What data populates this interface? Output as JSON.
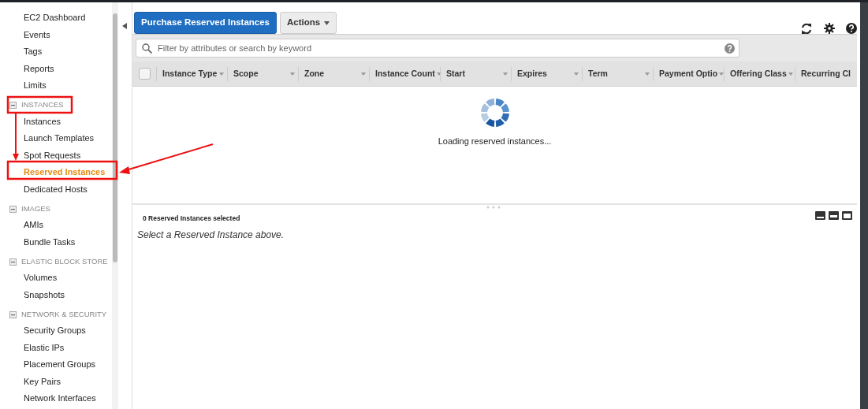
{
  "sidebar": {
    "items": [
      {
        "kind": "link",
        "label": "EC2 Dashboard",
        "selected": false
      },
      {
        "kind": "link",
        "label": "Events",
        "selected": false
      },
      {
        "kind": "link",
        "label": "Tags",
        "selected": false
      },
      {
        "kind": "link",
        "label": "Reports",
        "selected": false
      },
      {
        "kind": "link",
        "label": "Limits",
        "selected": false
      },
      {
        "kind": "section",
        "label": "INSTANCES",
        "expanded": true
      },
      {
        "kind": "link",
        "label": "Instances",
        "selected": false
      },
      {
        "kind": "link",
        "label": "Launch Templates",
        "selected": false
      },
      {
        "kind": "link",
        "label": "Spot Requests",
        "selected": false
      },
      {
        "kind": "link",
        "label": "Reserved Instances",
        "selected": true
      },
      {
        "kind": "link",
        "label": "Dedicated Hosts",
        "selected": false
      },
      {
        "kind": "section",
        "label": "IMAGES",
        "expanded": true
      },
      {
        "kind": "link",
        "label": "AMIs",
        "selected": false
      },
      {
        "kind": "link",
        "label": "Bundle Tasks",
        "selected": false
      },
      {
        "kind": "section",
        "label": "ELASTIC BLOCK STORE",
        "expanded": true
      },
      {
        "kind": "link",
        "label": "Volumes",
        "selected": false
      },
      {
        "kind": "link",
        "label": "Snapshots",
        "selected": false
      },
      {
        "kind": "section",
        "label": "NETWORK & SECURITY",
        "expanded": true
      },
      {
        "kind": "link",
        "label": "Security Groups",
        "selected": false
      },
      {
        "kind": "link",
        "label": "Elastic IPs",
        "selected": false
      },
      {
        "kind": "link",
        "label": "Placement Groups",
        "selected": false
      },
      {
        "kind": "link",
        "label": "Key Pairs",
        "selected": false
      },
      {
        "kind": "link",
        "label": "Network Interfaces",
        "selected": false
      }
    ]
  },
  "toolbar": {
    "primary_button": "Purchase Reserved Instances",
    "actions_button": "Actions"
  },
  "search": {
    "placeholder": "Filter by attributes or search by keyword"
  },
  "table": {
    "select_all": {
      "checked": false
    },
    "columns": [
      "Instance Type",
      "Scope",
      "Zone",
      "Instance Count",
      "Start",
      "Expires",
      "Term",
      "Payment Optio",
      "Offering Class",
      "Recurring Cl"
    ],
    "loading_text": "Loading reserved instances..."
  },
  "details": {
    "selection_count": "0 Reserved Instances selected",
    "message": "Select a Reserved Instance above."
  }
}
